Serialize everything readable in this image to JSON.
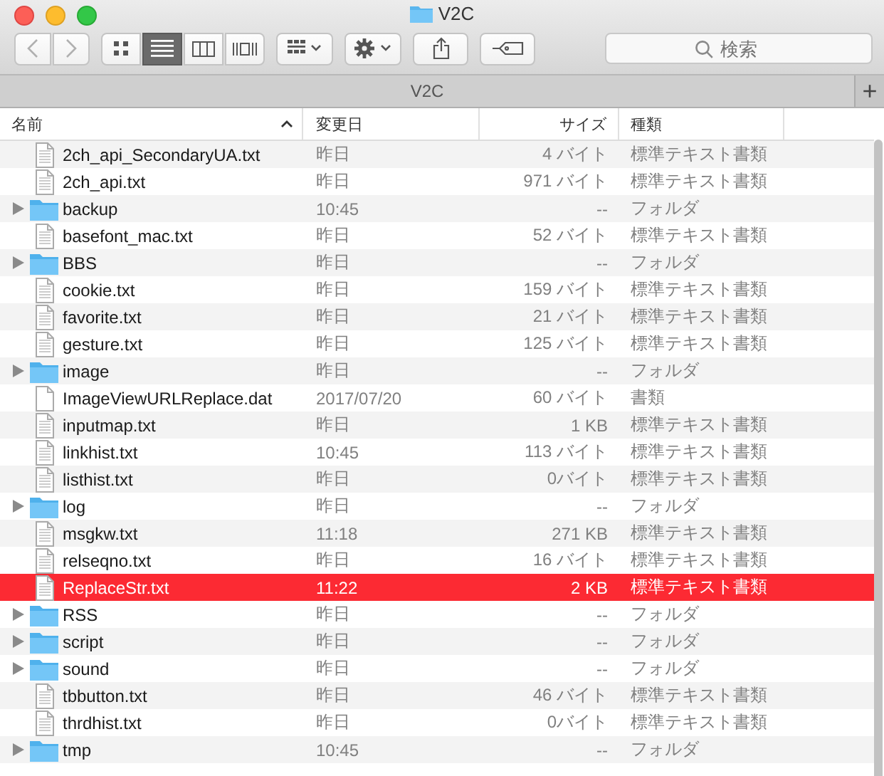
{
  "window": {
    "title": "V2C"
  },
  "views": [
    {
      "kind": "icons",
      "selected": false
    },
    {
      "kind": "list",
      "selected": true
    },
    {
      "kind": "columns",
      "selected": false
    },
    {
      "kind": "coverflow",
      "selected": false
    }
  ],
  "search": {
    "placeholder": "検索"
  },
  "tab": {
    "title": "V2C",
    "add": "+"
  },
  "columns": [
    {
      "label": "名前",
      "sorted": true
    },
    {
      "label": "変更日",
      "sorted": false
    },
    {
      "label": "サイズ",
      "sorted": false
    },
    {
      "label": "種類",
      "sorted": false
    }
  ],
  "rows": [
    {
      "kind": "text",
      "name": "2ch_api_SecondaryUA.txt",
      "date": "昨日",
      "size": "4 バイト",
      "type": "標準テキスト書類",
      "selected": false
    },
    {
      "kind": "text",
      "name": "2ch_api.txt",
      "date": "昨日",
      "size": "971 バイト",
      "type": "標準テキスト書類",
      "selected": false
    },
    {
      "kind": "folder",
      "name": "backup",
      "date": "10:45",
      "size": "--",
      "type": "フォルダ",
      "selected": false
    },
    {
      "kind": "text",
      "name": "basefont_mac.txt",
      "date": "昨日",
      "size": "52 バイト",
      "type": "標準テキスト書類",
      "selected": false
    },
    {
      "kind": "folder",
      "name": "BBS",
      "date": "昨日",
      "size": "--",
      "type": "フォルダ",
      "selected": false
    },
    {
      "kind": "text",
      "name": "cookie.txt",
      "date": "昨日",
      "size": "159 バイト",
      "type": "標準テキスト書類",
      "selected": false
    },
    {
      "kind": "text",
      "name": "favorite.txt",
      "date": "昨日",
      "size": "21 バイト",
      "type": "標準テキスト書類",
      "selected": false
    },
    {
      "kind": "text",
      "name": "gesture.txt",
      "date": "昨日",
      "size": "125 バイト",
      "type": "標準テキスト書類",
      "selected": false
    },
    {
      "kind": "folder",
      "name": "image",
      "date": "昨日",
      "size": "--",
      "type": "フォルダ",
      "selected": false
    },
    {
      "kind": "document",
      "name": "ImageViewURLReplace.dat",
      "date": "2017/07/20",
      "size": "60 バイト",
      "type": "書類",
      "selected": false
    },
    {
      "kind": "text",
      "name": "inputmap.txt",
      "date": "昨日",
      "size": "1 KB",
      "type": "標準テキスト書類",
      "selected": false
    },
    {
      "kind": "text",
      "name": "linkhist.txt",
      "date": "10:45",
      "size": "113 バイト",
      "type": "標準テキスト書類",
      "selected": false
    },
    {
      "kind": "text",
      "name": "listhist.txt",
      "date": "昨日",
      "size": "0バイト",
      "type": "標準テキスト書類",
      "selected": false
    },
    {
      "kind": "folder",
      "name": "log",
      "date": "昨日",
      "size": "--",
      "type": "フォルダ",
      "selected": false
    },
    {
      "kind": "text",
      "name": "msgkw.txt",
      "date": "11:18",
      "size": "271 KB",
      "type": "標準テキスト書類",
      "selected": false
    },
    {
      "kind": "text",
      "name": "relseqno.txt",
      "date": "昨日",
      "size": "16 バイト",
      "type": "標準テキスト書類",
      "selected": false
    },
    {
      "kind": "text",
      "name": "ReplaceStr.txt",
      "date": "11:22",
      "size": "2 KB",
      "type": "標準テキスト書類",
      "selected": true
    },
    {
      "kind": "folder",
      "name": "RSS",
      "date": "昨日",
      "size": "--",
      "type": "フォルダ",
      "selected": false
    },
    {
      "kind": "folder",
      "name": "script",
      "date": "昨日",
      "size": "--",
      "type": "フォルダ",
      "selected": false
    },
    {
      "kind": "folder",
      "name": "sound",
      "date": "昨日",
      "size": "--",
      "type": "フォルダ",
      "selected": false
    },
    {
      "kind": "text",
      "name": "tbbutton.txt",
      "date": "昨日",
      "size": "46 バイト",
      "type": "標準テキスト書類",
      "selected": false
    },
    {
      "kind": "text",
      "name": "thrdhist.txt",
      "date": "昨日",
      "size": "0バイト",
      "type": "標準テキスト書類",
      "selected": false
    },
    {
      "kind": "folder",
      "name": "tmp",
      "date": "10:45",
      "size": "--",
      "type": "フォルダ",
      "selected": false
    }
  ]
}
